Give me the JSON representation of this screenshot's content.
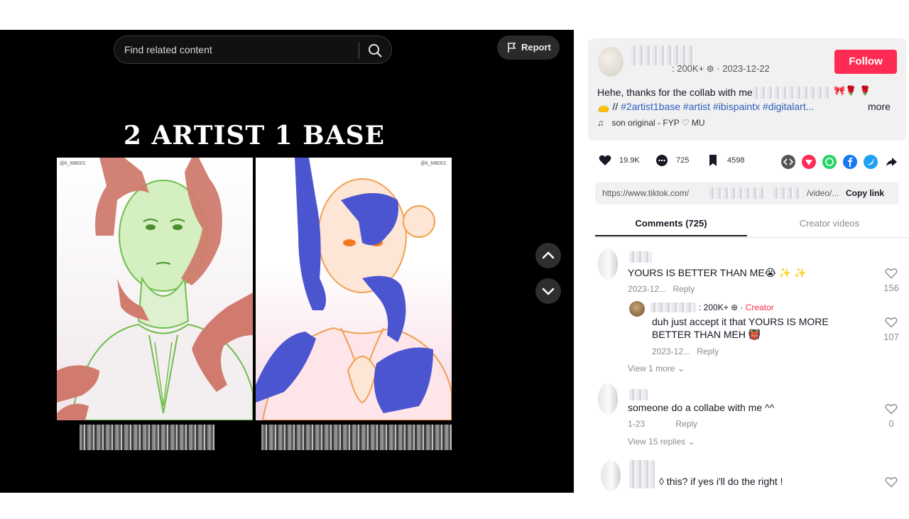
{
  "video": {
    "search_placeholder": "Find related content",
    "report_label": "Report",
    "title_overlay": "2 ARTIST 1 BASE",
    "watermark_left": "@k_MB001",
    "watermark_right": "@k_MB001"
  },
  "author": {
    "meta": ": 200K+ ⊛ · 2023-12-22",
    "follow_label": "Follow",
    "description_line1": "Hehe, thanks for the collab with meh",
    "description_emoji": "🎀🌹 🌹",
    "description_prefix": "👝 //",
    "hashtags": "#2artist1base #artist #ibispaintx #digitalart...",
    "more_label": "more",
    "sound": "son original - FYP ♡ MU"
  },
  "actions": {
    "likes": "19.9K",
    "comments": "725",
    "saves": "4598"
  },
  "link": {
    "url_start": "https://www.tiktok.com/",
    "url_end": "/video/...",
    "copy_label": "Copy link"
  },
  "tabs": {
    "comments": "Comments (725)",
    "creator_videos": "Creator videos"
  },
  "comments": [
    {
      "text": "YOURS IS BETTER THAN ME😭 ✨ ✨",
      "date": "2023-12...",
      "reply_label": "Reply",
      "likes": "156",
      "reply": {
        "author_suffix": ": 200K+ ⊛ ·",
        "creator_label": "Creator",
        "text_line1": "duh just accept it that YOURS IS MORE",
        "text_line2": "BETTER THAN MEH 👹",
        "date": "2023-12...",
        "reply_label": "Reply",
        "likes": "107"
      },
      "view_more": "View 1 more"
    },
    {
      "text": "someone do a collabe with me ^^",
      "date": "1-23",
      "reply_label": "Reply",
      "likes": "0",
      "view_more": "View 15 replies"
    },
    {
      "text": "◊ this? if yes i'll do the right !",
      "likes": ""
    }
  ],
  "colors": {
    "accent": "#fe2c55",
    "hashtag": "#2b5db9",
    "video_bg": "#000000"
  }
}
